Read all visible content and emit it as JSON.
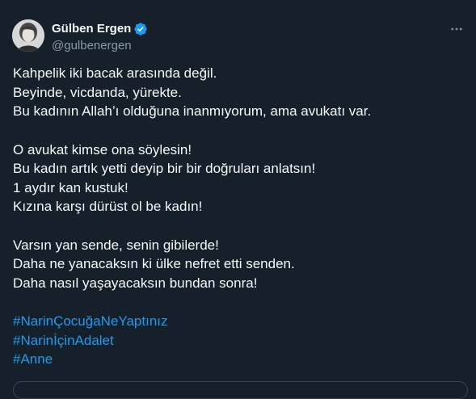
{
  "author": {
    "name": "Gülben Ergen",
    "handle": "@gulbenergen",
    "verified_color": "#1d9bf0"
  },
  "icons": {
    "verified": "verified-badge-icon",
    "more": "more-options-icon"
  },
  "tweet": {
    "paragraph1": [
      "Kahpelik iki bacak arasında değil.",
      "Beyinde, vicdanda, yürekte.",
      "Bu kadının Allah’ı olduğuna inanmıyorum, ama avukatı var."
    ],
    "paragraph2": [
      "O avukat kimse ona söylesin!",
      "Bu kadın artık yetti deyip bir bir doğruları anlatsın!",
      "1 aydır kan kustuk!",
      "Kızına karşı dürüst ol be kadın!"
    ],
    "paragraph3": [
      "Varsın yan sende, senin gibilerde!",
      "Daha ne yanacaksın ki ülke nefret etti senden.",
      "Daha nasıl yaşayacaksın bundan sonra!"
    ],
    "hashtags": [
      "#NarinÇocuğaNeYaptınız",
      "#Narinİçin​Adalet",
      "#Anne"
    ]
  },
  "colors": {
    "background": "#15202b",
    "text": "#f7f9f9",
    "secondary": "#8b98a5",
    "link": "#1d9bf0"
  }
}
